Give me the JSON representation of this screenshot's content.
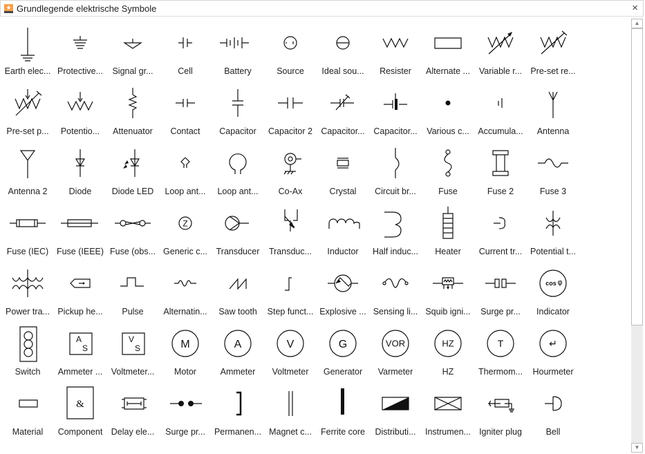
{
  "window": {
    "title": "Grundlegende elektrische Symbole",
    "close_label": "×"
  },
  "scrollbar": {
    "up_label": "▲",
    "down_label": "▼",
    "position_fraction": 0.0,
    "visible_fraction": 0.7
  },
  "symbols": [
    {
      "label": "Earth elec...",
      "icon": "earth-electrode"
    },
    {
      "label": "Protective...",
      "icon": "protective-earth"
    },
    {
      "label": "Signal gr...",
      "icon": "signal-ground"
    },
    {
      "label": "Cell",
      "icon": "cell"
    },
    {
      "label": "Battery",
      "icon": "battery"
    },
    {
      "label": "Source",
      "icon": "source"
    },
    {
      "label": "Ideal sou...",
      "icon": "ideal-source"
    },
    {
      "label": "Resister",
      "icon": "resistor"
    },
    {
      "label": "Alternate ...",
      "icon": "alternate-resistor"
    },
    {
      "label": "Variable r...",
      "icon": "variable-resistor"
    },
    {
      "label": "Pre-set re...",
      "icon": "preset-resistor"
    },
    {
      "label": "Pre-set p...",
      "icon": "preset-potentiometer"
    },
    {
      "label": "Potentio...",
      "icon": "potentiometer"
    },
    {
      "label": "Attenuator",
      "icon": "attenuator"
    },
    {
      "label": "Contact",
      "icon": "contact"
    },
    {
      "label": "Capacitor",
      "icon": "capacitor"
    },
    {
      "label": "Capacitor 2",
      "icon": "capacitor-2"
    },
    {
      "label": "Capacitor...",
      "icon": "capacitor-variable"
    },
    {
      "label": "Capacitor...",
      "icon": "capacitor-polarized"
    },
    {
      "label": "Various c...",
      "icon": "various-connection"
    },
    {
      "label": "Accumula...",
      "icon": "accumulator"
    },
    {
      "label": "Antenna",
      "icon": "antenna"
    },
    {
      "label": "Antenna 2",
      "icon": "antenna-2"
    },
    {
      "label": "Diode",
      "icon": "diode"
    },
    {
      "label": "Diode LED",
      "icon": "diode-led"
    },
    {
      "label": "Loop ant...",
      "icon": "loop-antenna-small"
    },
    {
      "label": "Loop ant...",
      "icon": "loop-antenna"
    },
    {
      "label": "Co-Ax",
      "icon": "co-ax"
    },
    {
      "label": "Crystal",
      "icon": "crystal"
    },
    {
      "label": "Circuit br...",
      "icon": "circuit-breaker"
    },
    {
      "label": "Fuse",
      "icon": "fuse"
    },
    {
      "label": "Fuse 2",
      "icon": "fuse-2"
    },
    {
      "label": "Fuse 3",
      "icon": "fuse-3"
    },
    {
      "label": "Fuse (IEC)",
      "icon": "fuse-iec"
    },
    {
      "label": "Fuse (IEEE)",
      "icon": "fuse-ieee"
    },
    {
      "label": "Fuse (obs...",
      "icon": "fuse-obsolete"
    },
    {
      "label": "Generic c...",
      "icon": "generic-component"
    },
    {
      "label": "Transducer",
      "icon": "transducer"
    },
    {
      "label": "Transduc...",
      "icon": "transducer-2"
    },
    {
      "label": "Inductor",
      "icon": "inductor"
    },
    {
      "label": "Half induc...",
      "icon": "half-inductor"
    },
    {
      "label": "Heater",
      "icon": "heater"
    },
    {
      "label": "Current tr...",
      "icon": "current-transformer"
    },
    {
      "label": "Potential t...",
      "icon": "potential-transformer"
    },
    {
      "label": "Power tra...",
      "icon": "power-transformer"
    },
    {
      "label": "Pickup he...",
      "icon": "pickup-head"
    },
    {
      "label": "Pulse",
      "icon": "pulse"
    },
    {
      "label": "Alternatin...",
      "icon": "alternating-current"
    },
    {
      "label": "Saw tooth",
      "icon": "saw-tooth"
    },
    {
      "label": "Step funct...",
      "icon": "step-function"
    },
    {
      "label": "Explosive ...",
      "icon": "explosive"
    },
    {
      "label": "Sensing li...",
      "icon": "sensing-link"
    },
    {
      "label": "Squib igni...",
      "icon": "squib-igniter"
    },
    {
      "label": "Surge pr...",
      "icon": "surge-protector"
    },
    {
      "label": "Indicator",
      "icon": "indicator"
    },
    {
      "label": "Switch",
      "icon": "switch"
    },
    {
      "label": "Ammeter ...",
      "icon": "ammeter-switch"
    },
    {
      "label": "Voltmeter...",
      "icon": "voltmeter-switch"
    },
    {
      "label": "Motor",
      "icon": "motor"
    },
    {
      "label": "Ammeter",
      "icon": "ammeter"
    },
    {
      "label": "Voltmeter",
      "icon": "voltmeter"
    },
    {
      "label": "Generator",
      "icon": "generator"
    },
    {
      "label": "Varmeter",
      "icon": "varmeter"
    },
    {
      "label": "HZ",
      "icon": "hz-meter"
    },
    {
      "label": "Thermom...",
      "icon": "thermometer"
    },
    {
      "label": "Hourmeter",
      "icon": "hourmeter"
    },
    {
      "label": "Material",
      "icon": "material"
    },
    {
      "label": "Component",
      "icon": "component"
    },
    {
      "label": "Delay ele...",
      "icon": "delay-element"
    },
    {
      "label": "Surge pr...",
      "icon": "surge-protector-2"
    },
    {
      "label": "Permanen...",
      "icon": "permanent-magnet"
    },
    {
      "label": "Magnet c...",
      "icon": "magnet-core"
    },
    {
      "label": "Ferrite core",
      "icon": "ferrite-core"
    },
    {
      "label": "Distributi...",
      "icon": "distribution"
    },
    {
      "label": "Instrumen...",
      "icon": "instrument"
    },
    {
      "label": "Igniter plug",
      "icon": "igniter-plug"
    },
    {
      "label": "Bell",
      "icon": "bell"
    }
  ],
  "meter_letters": {
    "motor": "M",
    "ammeter": "A",
    "voltmeter": "V",
    "generator": "G",
    "varmeter": "VOR",
    "hz-meter": "HZ",
    "thermometer": "T",
    "hourmeter": "↵",
    "ammeter-switch": [
      "A",
      "S"
    ],
    "voltmeter-switch": [
      "V",
      "S"
    ],
    "component": "&",
    "generic-component": "Z",
    "indicator": "cos φ"
  }
}
